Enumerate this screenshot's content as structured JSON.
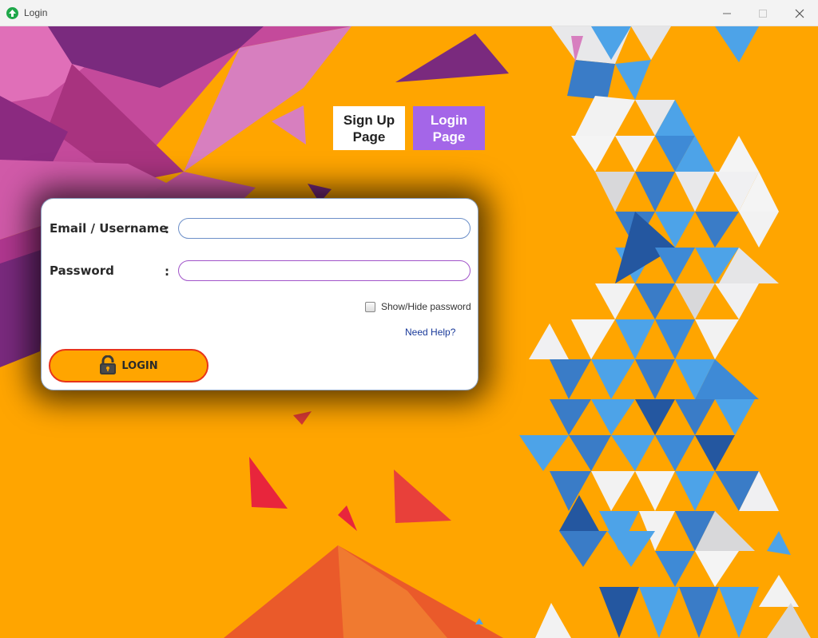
{
  "window": {
    "title": "Login",
    "icon": "app-up-arrow-icon",
    "accent": "#1fa84a"
  },
  "nav": {
    "signup_label": "Sign Up Page",
    "login_label": "Login Page",
    "login_active_color": "#a466e8"
  },
  "form": {
    "email_label": "Email / Username",
    "password_label": "Password",
    "colon": ":",
    "email_value": "",
    "password_value": "",
    "show_password_label": "Show/Hide password",
    "show_password_checked": false,
    "help_link": "Need Help?",
    "login_button": "LOGIN",
    "login_icon": "padlock-icon"
  },
  "colors": {
    "background": "#ffa500",
    "login_button_fill": "#ffa500",
    "login_button_border": "#e8341a"
  }
}
